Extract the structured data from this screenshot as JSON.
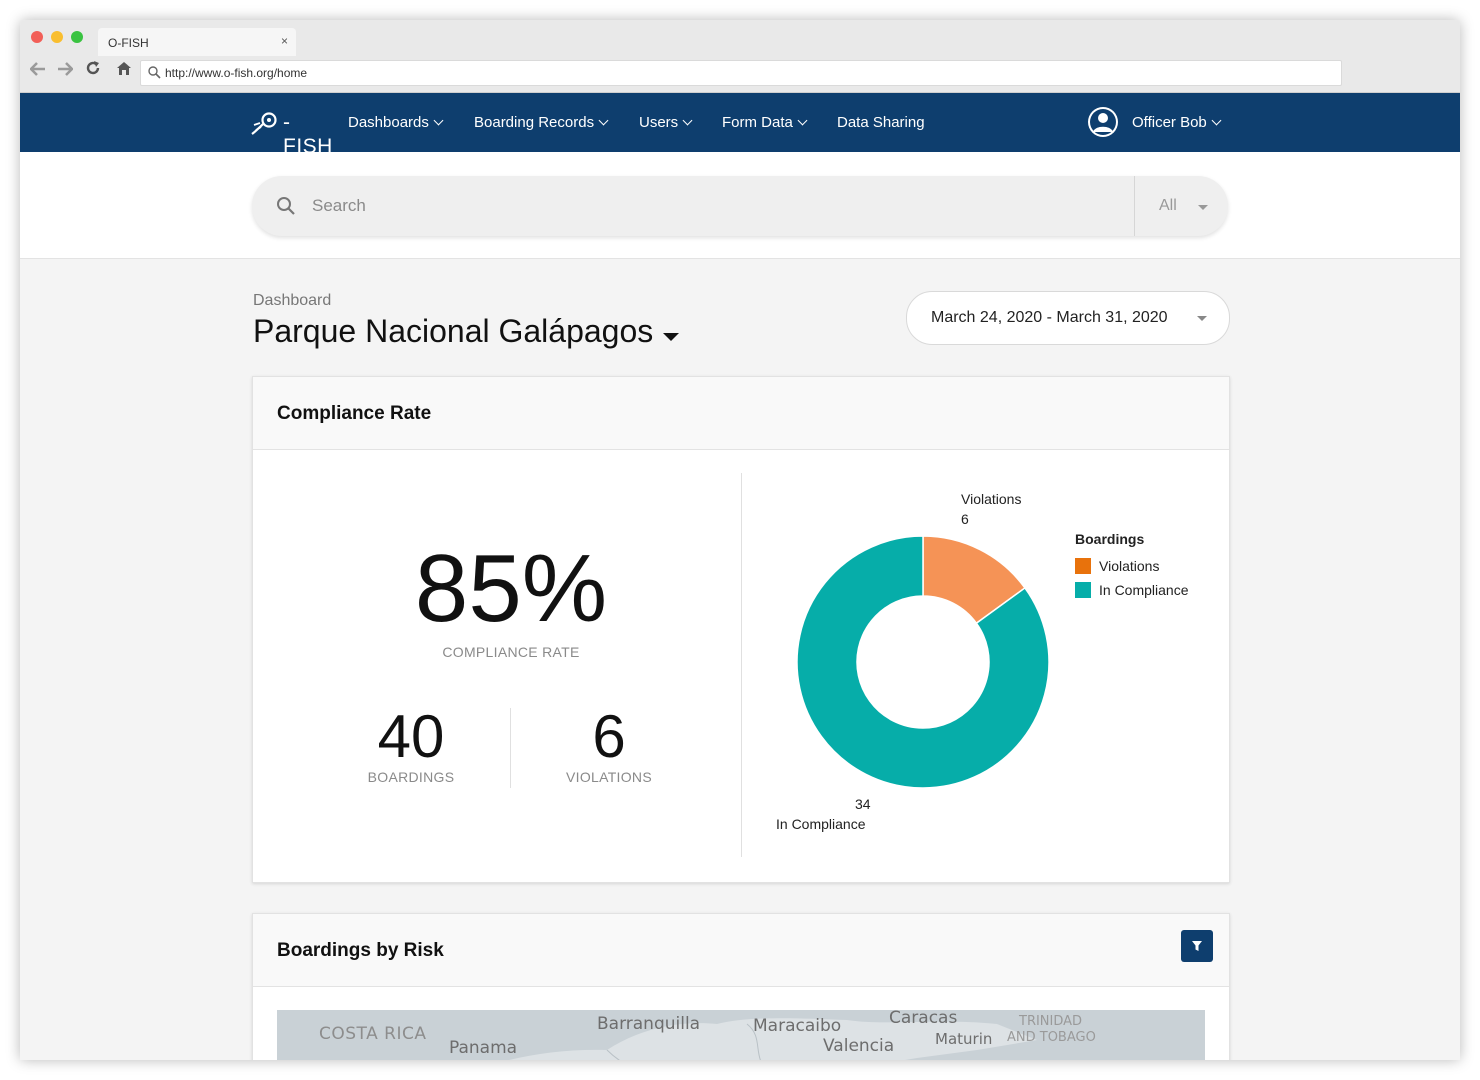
{
  "browser": {
    "tab_title": "O-FISH",
    "tab_close": "×",
    "url": "http://www.o-fish.org/home"
  },
  "nav": {
    "logo_text": "-FISH",
    "items": [
      {
        "label": "Dashboards"
      },
      {
        "label": "Boarding Records"
      },
      {
        "label": "Users"
      },
      {
        "label": "Form Data"
      },
      {
        "label": "Data Sharing"
      }
    ],
    "user_name": "Officer Bob"
  },
  "search": {
    "placeholder": "Search",
    "filter_value": "All"
  },
  "page": {
    "breadcrumb": "Dashboard",
    "title": "Parque Nacional Galápagos",
    "date_range": "March 24, 2020 - March 31, 2020"
  },
  "compliance": {
    "title": "Compliance Rate",
    "rate": "85%",
    "rate_label": "COMPLIANCE RATE",
    "boardings_value": "40",
    "boardings_label": "BOARDINGS",
    "violations_value": "6",
    "violations_label": "VIOLATIONS"
  },
  "chart_data": {
    "type": "pie",
    "labels": [
      "Violations",
      "In Compliance"
    ],
    "values": [
      6,
      34
    ],
    "colors": [
      "#f59356",
      "#06ada9"
    ],
    "legend_title": "Boardings",
    "legend_colors": [
      "#e8720c",
      "#06ada9"
    ],
    "legend_position": "right",
    "donut": true
  },
  "risk": {
    "title": "Boardings by Risk",
    "map_labels": [
      "COSTA RICA",
      "Panama",
      "Barranquilla",
      "Maracaibo",
      "Caracas",
      "Valencia",
      "Maturin",
      "TRINIDAD",
      "AND TOBAGO"
    ]
  },
  "colors": {
    "nav_bg": "#0e3e6e",
    "accent": "#06ada9",
    "violation": "#f59356"
  }
}
